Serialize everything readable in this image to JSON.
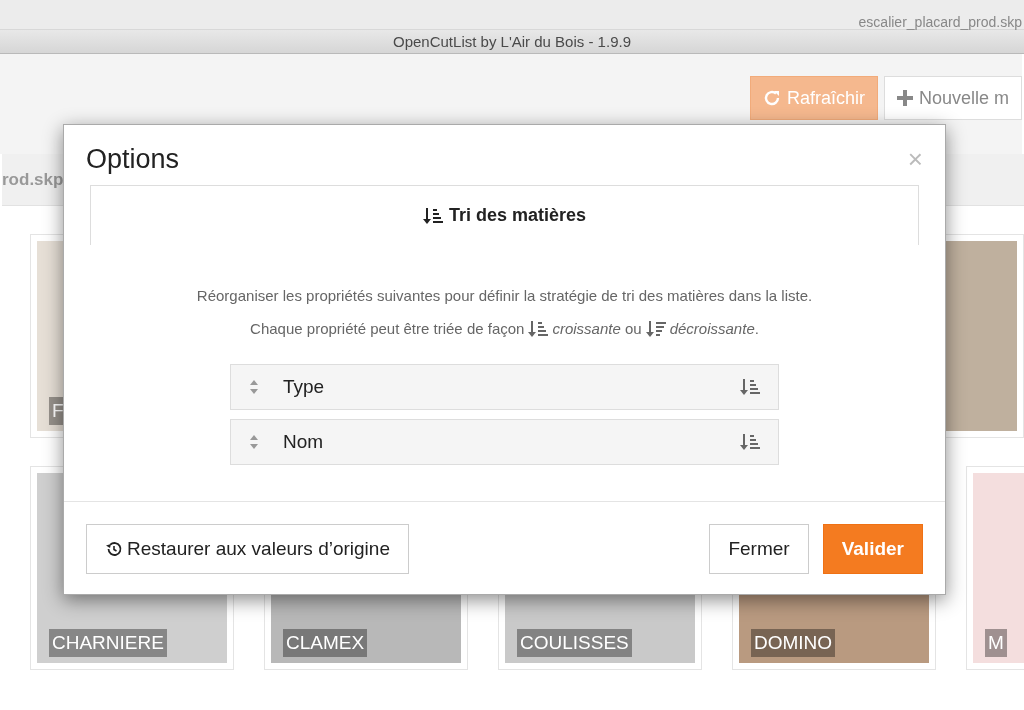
{
  "app": {
    "file_tab": "escalier_placard_prod.skp",
    "title": "OpenCutList by L'Air du Bois - 1.9.9",
    "toolbar": [
      {
        "kind": "primary",
        "label": "Rafraîchir"
      },
      {
        "kind": "secondary",
        "label": "Nouvelle m"
      }
    ],
    "file_label": "rod.skp",
    "tiles_top": [
      {
        "label": "F",
        "color": "#e6dfd6"
      },
      {
        "color": "#bfb09e"
      }
    ],
    "tiles_bottom": [
      {
        "label": "CHARNIERE",
        "color": "#cfcfcf"
      },
      {
        "label": "CLAMEX",
        "color": "#b8b8b8"
      },
      {
        "label": "COULISSES",
        "color": "#c9c9c9"
      },
      {
        "label": "DOMINO",
        "color": "#b99a80"
      },
      {
        "label": "M",
        "color": "#f4dede"
      }
    ]
  },
  "dialog": {
    "title": "Options",
    "close": "×",
    "tabs": [
      {
        "label": "Tri des matières",
        "selected": true
      }
    ],
    "intro": "Réorganiser les propriétés suivantes pour définir la stratégie de tri des matières dans la liste.",
    "hint_parts": [
      {
        "kind": "text",
        "text": "Chaque propriété peut être triée de façon"
      },
      {
        "kind": "ascending_icon"
      },
      {
        "kind": "text",
        "text": "*croissante* ou"
      },
      {
        "kind": "descending_icon"
      },
      {
        "kind": "text",
        "text": "*décroissante*."
      }
    ],
    "properties": [
      {
        "name": "Type",
        "descending": false
      },
      {
        "name": "Nom",
        "descending": false
      }
    ],
    "reset_button": "Restaurer aux valeurs d’origine",
    "close_button": "Fermer",
    "ok_button": "Valider"
  }
}
